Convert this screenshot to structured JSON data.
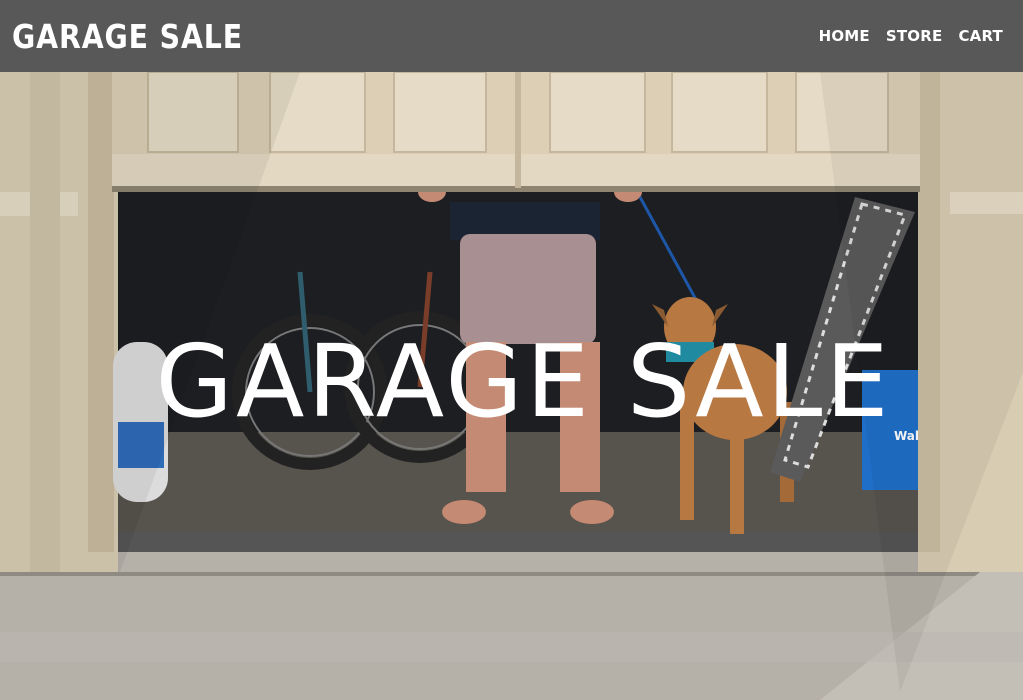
{
  "header": {
    "brand": "GARAGE SALE",
    "nav": [
      {
        "label": "HOME"
      },
      {
        "label": "STORE"
      },
      {
        "label": "CART"
      }
    ]
  },
  "hero": {
    "title": "GARAGE SALE",
    "image_label": "Wal",
    "colors": {
      "door": "#d9cdb5",
      "trim": "#cfc1a6",
      "interior": "#1d1f22",
      "floor": "#9a958c",
      "driveway": "#b2ada6",
      "bag": "#1e6dc4"
    }
  }
}
